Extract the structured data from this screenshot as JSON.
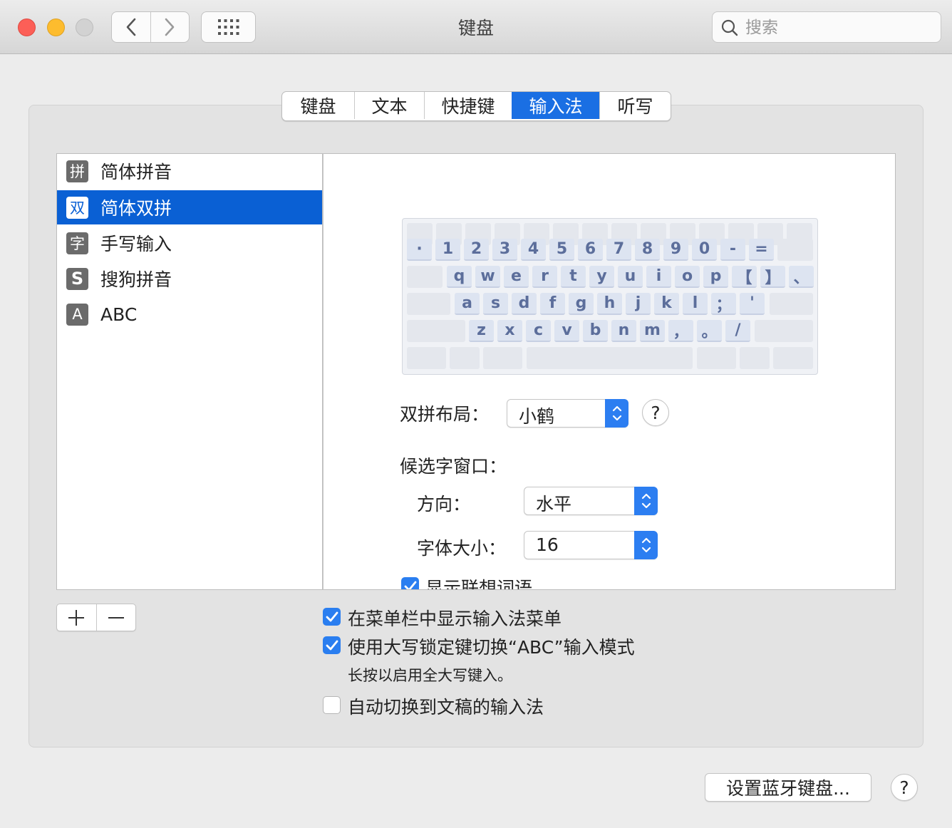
{
  "window": {
    "title": "键盘",
    "search_placeholder": "搜索"
  },
  "tabs": [
    {
      "label": "键盘",
      "active": false
    },
    {
      "label": "文本",
      "active": false
    },
    {
      "label": "快捷键",
      "active": false
    },
    {
      "label": "输入法",
      "active": true
    },
    {
      "label": "听写",
      "active": false
    }
  ],
  "input_sources": [
    {
      "icon_text": "拼",
      "icon": "pinyin-icon",
      "label": "简体拼音",
      "selected": false
    },
    {
      "icon_text": "双",
      "icon": "shuangpin-icon",
      "label": "简体双拼",
      "selected": true
    },
    {
      "icon_text": "字",
      "icon": "handwriting-icon",
      "label": "手写输入",
      "selected": false
    },
    {
      "icon_text": "S",
      "icon": "sogou-icon",
      "label": "搜狗拼音",
      "selected": false
    },
    {
      "icon_text": "A",
      "icon": "abc-icon",
      "label": "ABC",
      "selected": false
    }
  ],
  "keyboard": {
    "row1": [
      "·",
      "1",
      "2",
      "3",
      "4",
      "5",
      "6",
      "7",
      "8",
      "9",
      "0",
      "-",
      "="
    ],
    "row2": [
      "q",
      "w",
      "e",
      "r",
      "t",
      "y",
      "u",
      "i",
      "o",
      "p",
      "【",
      "】",
      "、"
    ],
    "row3": [
      "a",
      "s",
      "d",
      "f",
      "g",
      "h",
      "j",
      "k",
      "l",
      "；",
      "'"
    ],
    "row4": [
      "z",
      "x",
      "c",
      "v",
      "b",
      "n",
      "m",
      "，",
      "。",
      "/"
    ]
  },
  "settings": {
    "layout_label": "双拼布局：",
    "layout_value": "小鹤",
    "candidate_label": "候选字窗口：",
    "direction_label": "方向：",
    "direction_value": "水平",
    "font_size_label": "字体大小：",
    "font_size_value": "16",
    "predictive_label": "显示联想词语",
    "predictive_checked": true
  },
  "options": [
    {
      "label": "在菜单栏中显示输入法菜单",
      "checked": true
    },
    {
      "label": "使用大写锁定键切换“ABC”输入模式",
      "checked": true
    },
    {
      "label": "自动切换到文稿的输入法",
      "checked": false
    }
  ],
  "caps_note": "长按以启用全大写键入。",
  "bluetooth_button": "设置蓝牙键盘...",
  "help_glyph": "?",
  "colors": {
    "accent": "#1a6fe3",
    "selection": "#0a60d4",
    "key_text": "#5c6e9b"
  }
}
